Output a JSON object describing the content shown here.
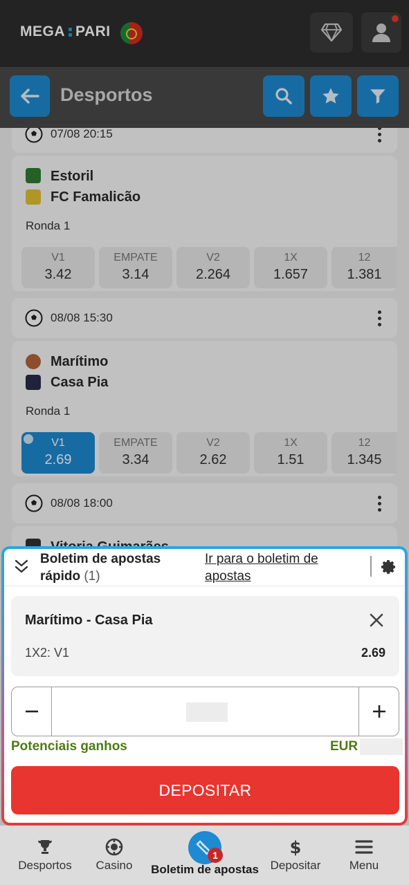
{
  "top_bar": {
    "logo_left": "MEGA",
    "logo_right": "PARI",
    "flag": "portugal-flag",
    "diamond_icon": "diamond-icon",
    "user_icon": "user-icon"
  },
  "header": {
    "title": "Desportos",
    "icons": [
      "back-arrow-icon",
      "search-icon",
      "star-icon",
      "filter-icon"
    ]
  },
  "matches": [
    {
      "datetime": "07/08 20:15",
      "teams": [
        "Estoril",
        "FC Famalicão"
      ],
      "round": "Ronda 1",
      "odds": [
        {
          "label": "V1",
          "value": "3.42"
        },
        {
          "label": "EMPATE",
          "value": "3.14"
        },
        {
          "label": "V2",
          "value": "2.264"
        },
        {
          "label": "1X",
          "value": "1.657"
        },
        {
          "label": "12",
          "value": "1.381"
        }
      ]
    },
    {
      "datetime": "08/08 15:30",
      "teams": [
        "Marítimo",
        "Casa Pia"
      ],
      "round": "Ronda 1",
      "odds": [
        {
          "label": "V1",
          "value": "2.69",
          "selected": true
        },
        {
          "label": "EMPATE",
          "value": "3.34"
        },
        {
          "label": "V2",
          "value": "2.62"
        },
        {
          "label": "1X",
          "value": "1.51"
        },
        {
          "label": "12",
          "value": "1.345"
        }
      ]
    },
    {
      "datetime": "08/08 18:00",
      "teams": [
        "Vitoria Guimarães"
      ]
    }
  ],
  "betslip": {
    "title": "Boletim de apostas rápido",
    "count": "(1)",
    "link": "Ir para o boletim de apostas",
    "selection": {
      "match": "Marítimo - Casa Pia",
      "market": "1X2: V1",
      "odd": "2.69"
    },
    "stake_value": "",
    "potential_label": "Potenciais ganhos",
    "currency": "EUR",
    "deposit_button": "DEPOSITAR"
  },
  "bottom_nav": [
    {
      "label": "Desportos",
      "icon": "trophy-icon"
    },
    {
      "label": "Casino",
      "icon": "casino-chip-icon"
    },
    {
      "label": "Boletim de apostas",
      "icon": "ticket-icon",
      "badge": "1"
    },
    {
      "label": "Depositar",
      "icon": "dollar-icon"
    },
    {
      "label": "Menu",
      "icon": "menu-icon"
    }
  ],
  "colors": {
    "accent": "#1e8ad1",
    "deposit": "#e8352f",
    "potential": "#4d7a17"
  }
}
